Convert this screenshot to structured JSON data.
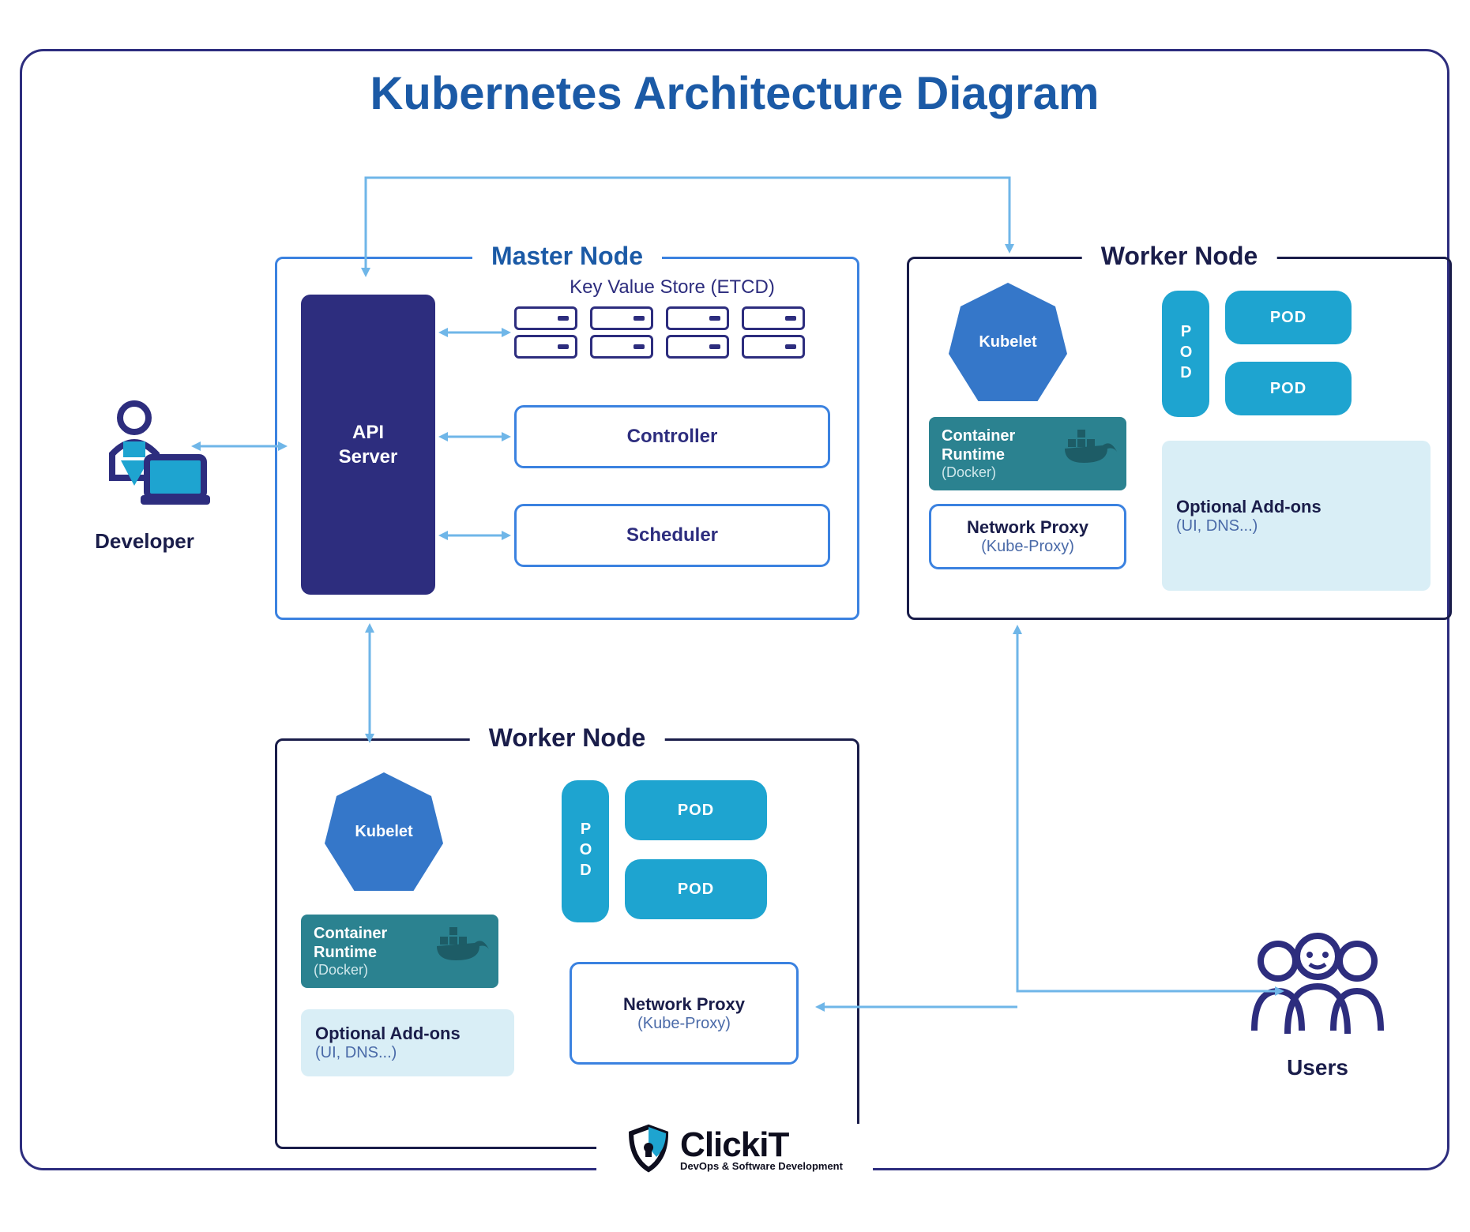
{
  "title": "Kubernetes Architecture Diagram",
  "developer_label": "Developer",
  "users_label": "Users",
  "master": {
    "title": "Master Node",
    "api_server": "API\nServer",
    "etcd_label": "Key Value Store (ETCD)",
    "controller": "Controller",
    "scheduler": "Scheduler"
  },
  "worker_tr": {
    "title": "Worker Node",
    "kubelet": "Kubelet",
    "container_runtime_title": "Container\nRuntime",
    "container_runtime_sub": "(Docker)",
    "network_proxy_title": "Network Proxy",
    "network_proxy_sub": "(Kube-Proxy)",
    "pod_vert": "POD",
    "pod1": "POD",
    "pod2": "POD",
    "addons_title": "Optional Add-ons",
    "addons_sub": "(UI, DNS...)"
  },
  "worker_b": {
    "title": "Worker Node",
    "kubelet": "Kubelet",
    "container_runtime_title": "Container\nRuntime",
    "container_runtime_sub": "(Docker)",
    "network_proxy_title": "Network Proxy",
    "network_proxy_sub": "(Kube-Proxy)",
    "pod_vert": "POD",
    "pod1": "POD",
    "pod2": "POD",
    "addons_title": "Optional Add-ons",
    "addons_sub": "(UI, DNS...)"
  },
  "logo": {
    "brand": "ClickiT",
    "tagline": "DevOps & Software Development"
  },
  "colors": {
    "title_blue": "#1b5aa6",
    "dark_navy": "#1a1d4a",
    "purple": "#2d2d7e",
    "bright_blue": "#3b82e0",
    "teal": "#2b8290",
    "cyan": "#1ea4d0",
    "light_cyan": "#d9eef6",
    "arrow": "#6fb6e8"
  }
}
